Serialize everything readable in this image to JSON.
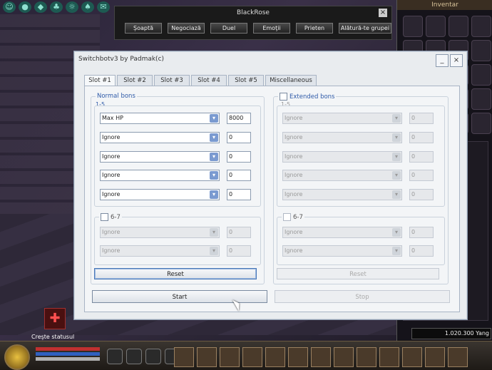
{
  "game": {
    "chat_window": {
      "title": "BlackRose",
      "buttons": [
        "Șoaptă",
        "Negociază",
        "Duel",
        "Emoţii",
        "Prieten",
        "Alătură-te grupei"
      ]
    },
    "inventory": {
      "title": "Inventar",
      "yang": "1.020.300 Yang"
    },
    "crest_label": "Creşte statusul"
  },
  "dialog": {
    "title": "Switchbotv3 by Padmak(c)",
    "tabs": [
      "Slot #1",
      "Slot #2",
      "Slot #3",
      "Slot #4",
      "Slot #5",
      "Miscellaneous"
    ],
    "active_tab": "Slot #1",
    "normal_bons": {
      "label": "Normal bons",
      "range_1_5": "1-5",
      "rows": [
        {
          "select": "Max HP",
          "value": "8000"
        },
        {
          "select": "Ignore",
          "value": "0"
        },
        {
          "select": "Ignore",
          "value": "0"
        },
        {
          "select": "Ignore",
          "value": "0"
        },
        {
          "select": "Ignore",
          "value": "0"
        }
      ],
      "range_6_7": "6-7",
      "rows_6_7": [
        {
          "select": "Ignore",
          "value": "0"
        },
        {
          "select": "Ignore",
          "value": "0"
        }
      ],
      "reset": "Reset"
    },
    "extended_bons": {
      "label": "Extended bons",
      "range_1_5": "1-5",
      "rows": [
        {
          "select": "Ignore",
          "value": "0"
        },
        {
          "select": "Ignore",
          "value": "0"
        },
        {
          "select": "Ignore",
          "value": "0"
        },
        {
          "select": "Ignore",
          "value": "0"
        },
        {
          "select": "Ignore",
          "value": "0"
        }
      ],
      "range_6_7": "6-7",
      "rows_6_7": [
        {
          "select": "Ignore",
          "value": "0"
        },
        {
          "select": "Ignore",
          "value": "0"
        }
      ],
      "reset": "Reset"
    },
    "start": "Start",
    "stop": "Stop",
    "minimize": "_",
    "close": "×"
  }
}
